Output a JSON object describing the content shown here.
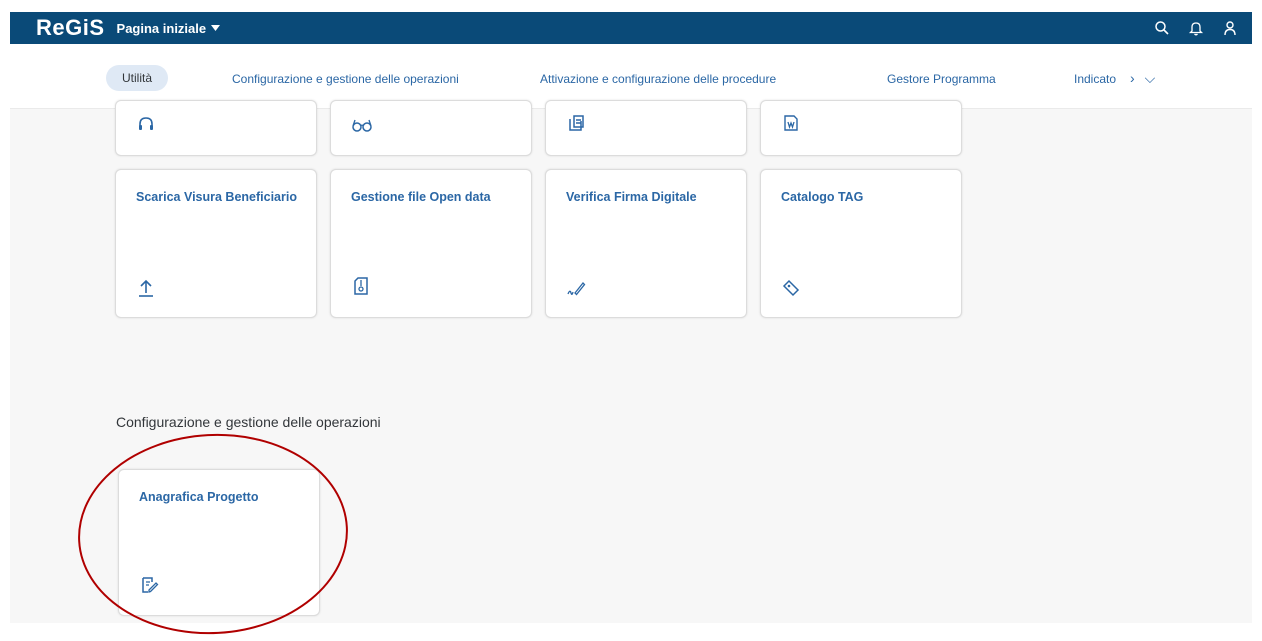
{
  "shell": {
    "logo": "ReGiS",
    "title": "Pagina iniziale"
  },
  "tabs": [
    {
      "label": "Utilità"
    },
    {
      "label": "Configurazione e gestione delle operazioni"
    },
    {
      "label": "Attivazione e configurazione delle procedure"
    },
    {
      "label": "Gestore Programma"
    },
    {
      "label": "Indicato"
    }
  ],
  "tiles_top": [
    {
      "icon": "headset-icon"
    },
    {
      "icon": "glasses-icon"
    },
    {
      "icon": "document-stack-icon"
    },
    {
      "icon": "word-document-icon"
    }
  ],
  "tiles": [
    {
      "label": "Scarica Visura Beneficiario",
      "icon": "upload-icon"
    },
    {
      "label": "Gestione file Open data",
      "icon": "zip-file-icon"
    },
    {
      "label": "Verifica Firma Digitale",
      "icon": "signature-icon"
    },
    {
      "label": "Catalogo TAG",
      "icon": "tags-icon"
    }
  ],
  "section": {
    "title": "Configurazione e gestione delle operazioni",
    "tile": {
      "label": "Anagrafica Progetto",
      "icon": "edit-document-icon"
    }
  },
  "colors": {
    "shell": "#0a4a78",
    "link": "#2b67a5",
    "annotation": "#b00000"
  }
}
